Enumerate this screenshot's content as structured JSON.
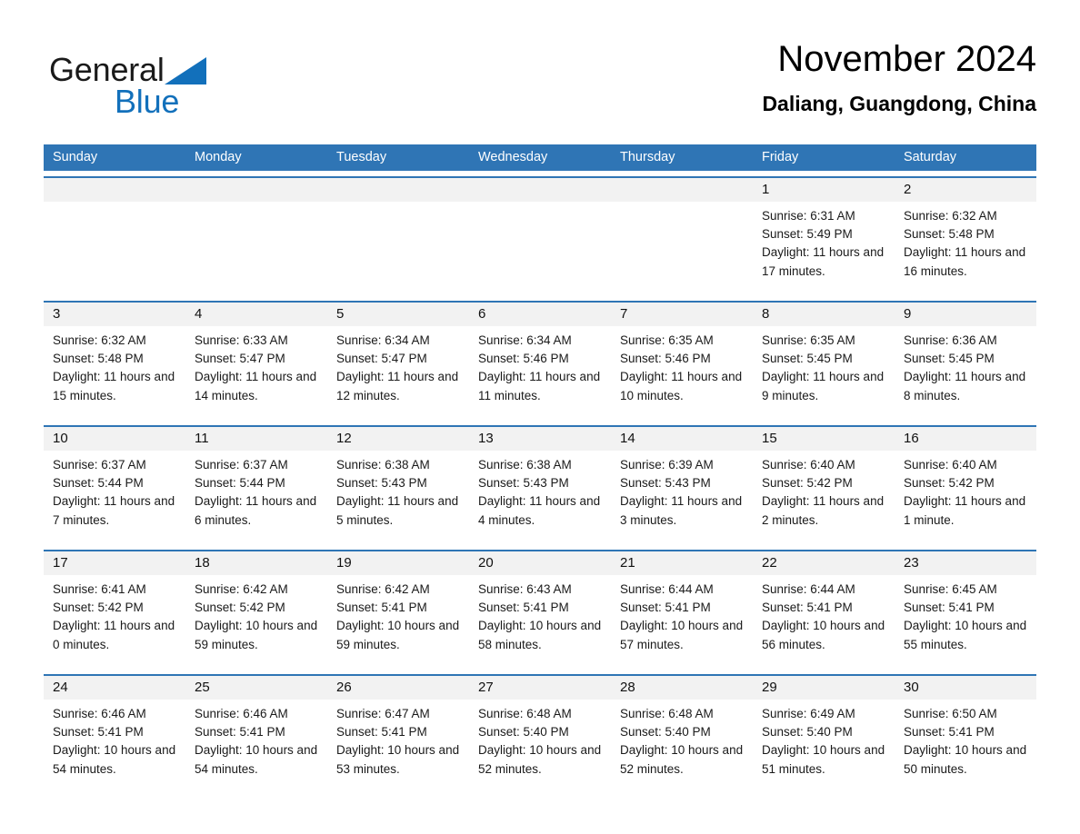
{
  "brand": {
    "name_part1": "General",
    "name_part2": "Blue",
    "triangle_color": "#1270bb",
    "text_color": "#1a1a1a"
  },
  "header": {
    "title": "November 2024",
    "subtitle": "Daliang, Guangdong, China"
  },
  "theme": {
    "header_blue": "#2f75b5",
    "row_divider_blue": "#2f75b5",
    "daynum_band": "#f2f2f2"
  },
  "weekdays": [
    "Sunday",
    "Monday",
    "Tuesday",
    "Wednesday",
    "Thursday",
    "Friday",
    "Saturday"
  ],
  "labels": {
    "sunrise_prefix": "Sunrise:",
    "sunset_prefix": "Sunset:",
    "daylight_prefix": "Daylight:"
  },
  "weeks": [
    [
      {
        "empty": true
      },
      {
        "empty": true
      },
      {
        "empty": true
      },
      {
        "empty": true
      },
      {
        "empty": true
      },
      {
        "day": "1",
        "sunrise": "Sunrise: 6:31 AM",
        "sunset": "Sunset: 5:49 PM",
        "daylight": "Daylight: 11 hours and 17 minutes."
      },
      {
        "day": "2",
        "sunrise": "Sunrise: 6:32 AM",
        "sunset": "Sunset: 5:48 PM",
        "daylight": "Daylight: 11 hours and 16 minutes."
      }
    ],
    [
      {
        "day": "3",
        "sunrise": "Sunrise: 6:32 AM",
        "sunset": "Sunset: 5:48 PM",
        "daylight": "Daylight: 11 hours and 15 minutes."
      },
      {
        "day": "4",
        "sunrise": "Sunrise: 6:33 AM",
        "sunset": "Sunset: 5:47 PM",
        "daylight": "Daylight: 11 hours and 14 minutes."
      },
      {
        "day": "5",
        "sunrise": "Sunrise: 6:34 AM",
        "sunset": "Sunset: 5:47 PM",
        "daylight": "Daylight: 11 hours and 12 minutes."
      },
      {
        "day": "6",
        "sunrise": "Sunrise: 6:34 AM",
        "sunset": "Sunset: 5:46 PM",
        "daylight": "Daylight: 11 hours and 11 minutes."
      },
      {
        "day": "7",
        "sunrise": "Sunrise: 6:35 AM",
        "sunset": "Sunset: 5:46 PM",
        "daylight": "Daylight: 11 hours and 10 minutes."
      },
      {
        "day": "8",
        "sunrise": "Sunrise: 6:35 AM",
        "sunset": "Sunset: 5:45 PM",
        "daylight": "Daylight: 11 hours and 9 minutes."
      },
      {
        "day": "9",
        "sunrise": "Sunrise: 6:36 AM",
        "sunset": "Sunset: 5:45 PM",
        "daylight": "Daylight: 11 hours and 8 minutes."
      }
    ],
    [
      {
        "day": "10",
        "sunrise": "Sunrise: 6:37 AM",
        "sunset": "Sunset: 5:44 PM",
        "daylight": "Daylight: 11 hours and 7 minutes."
      },
      {
        "day": "11",
        "sunrise": "Sunrise: 6:37 AM",
        "sunset": "Sunset: 5:44 PM",
        "daylight": "Daylight: 11 hours and 6 minutes."
      },
      {
        "day": "12",
        "sunrise": "Sunrise: 6:38 AM",
        "sunset": "Sunset: 5:43 PM",
        "daylight": "Daylight: 11 hours and 5 minutes."
      },
      {
        "day": "13",
        "sunrise": "Sunrise: 6:38 AM",
        "sunset": "Sunset: 5:43 PM",
        "daylight": "Daylight: 11 hours and 4 minutes."
      },
      {
        "day": "14",
        "sunrise": "Sunrise: 6:39 AM",
        "sunset": "Sunset: 5:43 PM",
        "daylight": "Daylight: 11 hours and 3 minutes."
      },
      {
        "day": "15",
        "sunrise": "Sunrise: 6:40 AM",
        "sunset": "Sunset: 5:42 PM",
        "daylight": "Daylight: 11 hours and 2 minutes."
      },
      {
        "day": "16",
        "sunrise": "Sunrise: 6:40 AM",
        "sunset": "Sunset: 5:42 PM",
        "daylight": "Daylight: 11 hours and 1 minute."
      }
    ],
    [
      {
        "day": "17",
        "sunrise": "Sunrise: 6:41 AM",
        "sunset": "Sunset: 5:42 PM",
        "daylight": "Daylight: 11 hours and 0 minutes."
      },
      {
        "day": "18",
        "sunrise": "Sunrise: 6:42 AM",
        "sunset": "Sunset: 5:42 PM",
        "daylight": "Daylight: 10 hours and 59 minutes."
      },
      {
        "day": "19",
        "sunrise": "Sunrise: 6:42 AM",
        "sunset": "Sunset: 5:41 PM",
        "daylight": "Daylight: 10 hours and 59 minutes."
      },
      {
        "day": "20",
        "sunrise": "Sunrise: 6:43 AM",
        "sunset": "Sunset: 5:41 PM",
        "daylight": "Daylight: 10 hours and 58 minutes."
      },
      {
        "day": "21",
        "sunrise": "Sunrise: 6:44 AM",
        "sunset": "Sunset: 5:41 PM",
        "daylight": "Daylight: 10 hours and 57 minutes."
      },
      {
        "day": "22",
        "sunrise": "Sunrise: 6:44 AM",
        "sunset": "Sunset: 5:41 PM",
        "daylight": "Daylight: 10 hours and 56 minutes."
      },
      {
        "day": "23",
        "sunrise": "Sunrise: 6:45 AM",
        "sunset": "Sunset: 5:41 PM",
        "daylight": "Daylight: 10 hours and 55 minutes."
      }
    ],
    [
      {
        "day": "24",
        "sunrise": "Sunrise: 6:46 AM",
        "sunset": "Sunset: 5:41 PM",
        "daylight": "Daylight: 10 hours and 54 minutes."
      },
      {
        "day": "25",
        "sunrise": "Sunrise: 6:46 AM",
        "sunset": "Sunset: 5:41 PM",
        "daylight": "Daylight: 10 hours and 54 minutes."
      },
      {
        "day": "26",
        "sunrise": "Sunrise: 6:47 AM",
        "sunset": "Sunset: 5:41 PM",
        "daylight": "Daylight: 10 hours and 53 minutes."
      },
      {
        "day": "27",
        "sunrise": "Sunrise: 6:48 AM",
        "sunset": "Sunset: 5:40 PM",
        "daylight": "Daylight: 10 hours and 52 minutes."
      },
      {
        "day": "28",
        "sunrise": "Sunrise: 6:48 AM",
        "sunset": "Sunset: 5:40 PM",
        "daylight": "Daylight: 10 hours and 52 minutes."
      },
      {
        "day": "29",
        "sunrise": "Sunrise: 6:49 AM",
        "sunset": "Sunset: 5:40 PM",
        "daylight": "Daylight: 10 hours and 51 minutes."
      },
      {
        "day": "30",
        "sunrise": "Sunrise: 6:50 AM",
        "sunset": "Sunset: 5:41 PM",
        "daylight": "Daylight: 10 hours and 50 minutes."
      }
    ]
  ]
}
